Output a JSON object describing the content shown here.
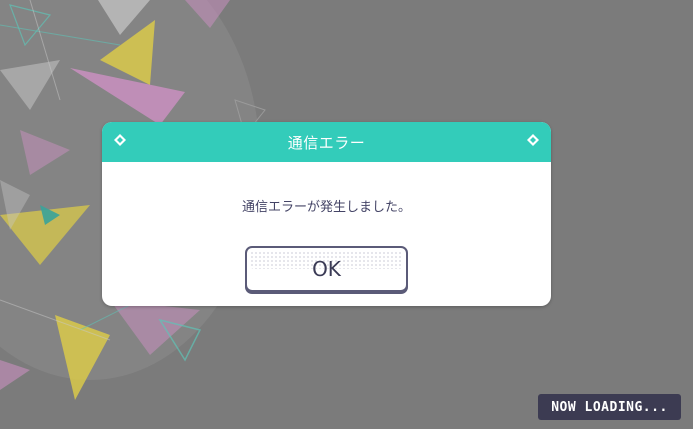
{
  "dialog": {
    "title": "通信エラー",
    "message": "通信エラーが発生しました。",
    "ok_label": "OK",
    "header_color": "#33ccba"
  },
  "loading": {
    "label": "NOW LOADING..."
  },
  "background": {
    "base_color": "#7a7a7a",
    "shape_colors": [
      "#d9c94a",
      "#c98fc0",
      "#5fc3b6",
      "#c9c9c9"
    ]
  }
}
